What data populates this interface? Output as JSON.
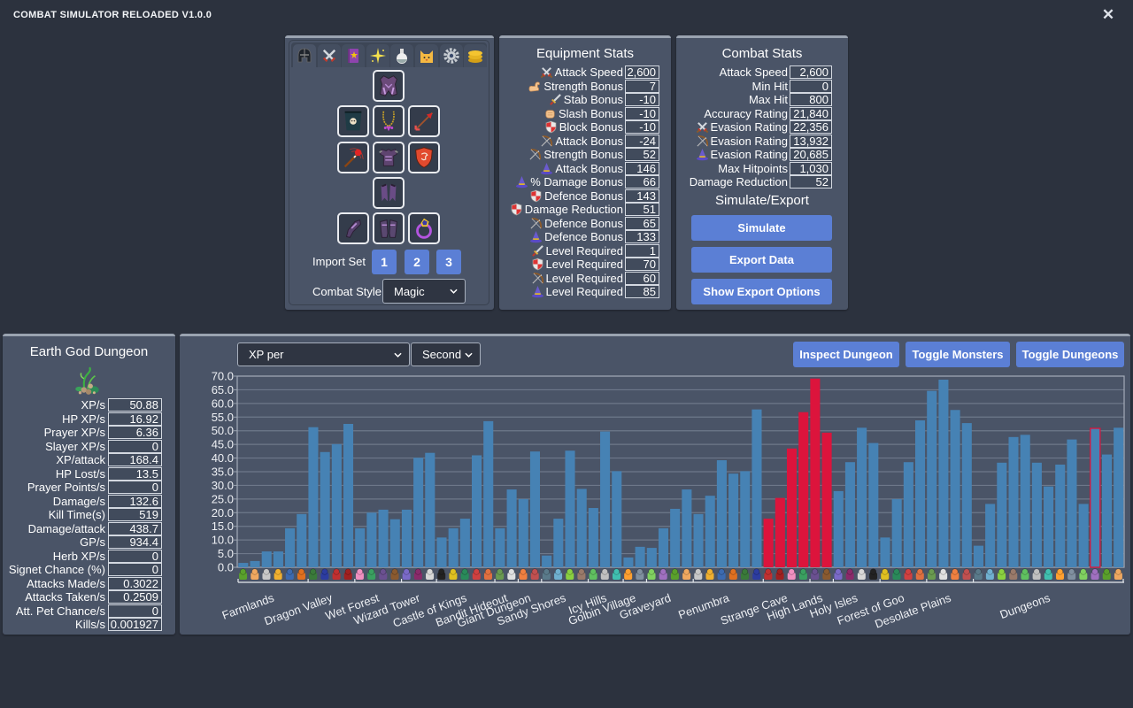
{
  "app": {
    "title": "COMBAT SIMULATOR RELOADED V1.0.0",
    "close_icon": "close-icon",
    "close_glyph": "✕"
  },
  "equipment_panel": {
    "tabs": [
      {
        "id": "equipment",
        "icon": "helmet-icon",
        "active": true
      },
      {
        "id": "combat",
        "icon": "crossed-swords-icon",
        "active": false
      },
      {
        "id": "spellbook",
        "icon": "spellbook-icon",
        "active": false
      },
      {
        "id": "prayer",
        "icon": "sparkle-icon",
        "active": false
      },
      {
        "id": "potions",
        "icon": "potion-icon",
        "active": false
      },
      {
        "id": "pets",
        "icon": "cat-icon",
        "active": false
      },
      {
        "id": "settings",
        "icon": "gear-icon",
        "active": false
      },
      {
        "id": "gp",
        "icon": "coins-icon",
        "active": false
      }
    ],
    "slots": [
      {
        "slot": "helmet",
        "icon": "helmet-slot-icon"
      },
      {
        "slot": "cape",
        "icon": "cape-slot-icon"
      },
      {
        "slot": "amulet",
        "icon": "amulet-slot-icon"
      },
      {
        "slot": "quiver",
        "icon": "arrow-slot-icon"
      },
      {
        "slot": "weapon",
        "icon": "staff-slot-icon"
      },
      {
        "slot": "platebody",
        "icon": "platebody-slot-icon"
      },
      {
        "slot": "shield",
        "icon": "shield-slot-icon"
      },
      {
        "slot": "platelegs",
        "icon": "platelegs-slot-icon"
      },
      {
        "slot": "gloves",
        "icon": "gloves-slot-icon"
      },
      {
        "slot": "boots",
        "icon": "boots-slot-icon"
      },
      {
        "slot": "ring",
        "icon": "ring-slot-icon"
      }
    ],
    "import_set_label": "Import Set",
    "import_buttons": [
      "1",
      "2",
      "3"
    ],
    "combat_style_label": "Combat Style",
    "combat_style_value": "Magic"
  },
  "equipment_stats": {
    "title": "Equipment Stats",
    "rows": [
      {
        "icon": "melee-icon",
        "label": "Attack Speed",
        "value": "2,600"
      },
      {
        "icon": "strength-icon",
        "label": "Strength Bonus",
        "value": "7"
      },
      {
        "icon": "stab-icon",
        "label": "Stab Bonus",
        "value": "-10"
      },
      {
        "icon": "slash-icon",
        "label": "Slash Bonus",
        "value": "-10"
      },
      {
        "icon": "defence-icon",
        "label": "Block Bonus",
        "value": "-10"
      },
      {
        "icon": "ranged-icon",
        "label": "Attack Bonus",
        "value": "-24"
      },
      {
        "icon": "ranged-icon",
        "label": "Strength Bonus",
        "value": "52"
      },
      {
        "icon": "magic-icon",
        "label": "Attack Bonus",
        "value": "146"
      },
      {
        "icon": "magic-icon",
        "label": "% Damage Bonus",
        "value": "66"
      },
      {
        "icon": "defence-icon",
        "label": "Defence Bonus",
        "value": "143"
      },
      {
        "icon": "defence-icon",
        "label": "Damage Reduction",
        "value": "51"
      },
      {
        "icon": "ranged-icon",
        "label": "Defence Bonus",
        "value": "65"
      },
      {
        "icon": "magic-icon",
        "label": "Defence Bonus",
        "value": "133"
      },
      {
        "icon": "attack-icon",
        "label": "Level Required",
        "value": "1"
      },
      {
        "icon": "defence-icon",
        "label": "Level Required",
        "value": "70"
      },
      {
        "icon": "ranged-icon",
        "label": "Level Required",
        "value": "60"
      },
      {
        "icon": "magic-icon",
        "label": "Level Required",
        "value": "85"
      }
    ]
  },
  "combat_stats": {
    "title": "Combat Stats",
    "rows": [
      {
        "icon": null,
        "label": "Attack Speed",
        "value": "2,600"
      },
      {
        "icon": null,
        "label": "Min Hit",
        "value": "0"
      },
      {
        "icon": null,
        "label": "Max Hit",
        "value": "800"
      },
      {
        "icon": null,
        "label": "Accuracy Rating",
        "value": "21,840"
      },
      {
        "icon": "melee-icon",
        "label": "Evasion Rating",
        "value": "22,356"
      },
      {
        "icon": "ranged-icon",
        "label": "Evasion Rating",
        "value": "13,932"
      },
      {
        "icon": "magic-icon",
        "label": "Evasion Rating",
        "value": "20,685"
      },
      {
        "icon": null,
        "label": "Max Hitpoints",
        "value": "1,030"
      },
      {
        "icon": null,
        "label": "Damage Reduction",
        "value": "52"
      }
    ],
    "simulate_export_title": "Simulate/Export",
    "buttons": {
      "simulate": "Simulate",
      "export": "Export Data",
      "show_options": "Show Export Options"
    }
  },
  "dungeon_panel": {
    "title": "Earth God Dungeon",
    "icon": "earth-god-dungeon-icon",
    "rows": [
      {
        "label": "XP/s",
        "value": "50.88"
      },
      {
        "label": "HP XP/s",
        "value": "16.92"
      },
      {
        "label": "Prayer XP/s",
        "value": "6.36"
      },
      {
        "label": "Slayer XP/s",
        "value": "0"
      },
      {
        "label": "XP/attack",
        "value": "168.4"
      },
      {
        "label": "HP Lost/s",
        "value": "13.5"
      },
      {
        "label": "Prayer Points/s",
        "value": "0"
      },
      {
        "label": "Damage/s",
        "value": "132.6"
      },
      {
        "label": "Kill Time(s)",
        "value": "519"
      },
      {
        "label": "Damage/attack",
        "value": "438.7"
      },
      {
        "label": "GP/s",
        "value": "934.4"
      },
      {
        "label": "Herb XP/s",
        "value": "0"
      },
      {
        "label": "Signet Chance (%)",
        "value": "0"
      },
      {
        "label": "Attacks Made/s",
        "value": "0.3022"
      },
      {
        "label": "Attacks Taken/s",
        "value": "0.2509"
      },
      {
        "label": "Att. Pet Chance/s",
        "value": "0"
      },
      {
        "label": "Kills/s",
        "value": "0.001927"
      }
    ]
  },
  "chart_panel": {
    "stat_select": "XP per",
    "time_select": "Second",
    "buttons": {
      "inspect": "Inspect Dungeon",
      "toggle_monsters": "Toggle Monsters",
      "toggle_dungeons": "Toggle Dungeons"
    }
  },
  "chart_data": {
    "type": "bar",
    "title": "",
    "xlabel": "",
    "ylabel": "",
    "metric": "XP per Second",
    "ylim": [
      0,
      70
    ],
    "yticks": [
      "0.0",
      "5.0",
      "10.0",
      "15.0",
      "20.0",
      "25.0",
      "30.0",
      "35.0",
      "40.0",
      "45.0",
      "50.0",
      "55.0",
      "60.0",
      "65.0",
      "70.0"
    ],
    "grid": true,
    "legend": "none",
    "categories": [
      "Farmlands",
      "Dragon Valley",
      "Wet Forest",
      "Wizard Tower",
      "Castle of Kings",
      "Bandit Hideout",
      "Giant Dungeon",
      "Sandy Shores",
      "Icy Hills",
      "Golbin Village",
      "Graveyard",
      "Penumbra",
      "Strange Cave",
      "High Lands",
      "Holy Isles",
      "Forest of Goo",
      "Desolate Plains",
      "Dungeons"
    ],
    "groups": [
      {
        "label": "Farmlands",
        "start": 1,
        "end": 6
      },
      {
        "label": "Dragon Valley",
        "start": 7,
        "end": 10
      },
      {
        "label": "Wet Forest",
        "start": 11,
        "end": 14
      },
      {
        "label": "Wizard Tower",
        "start": 15,
        "end": 17
      },
      {
        "label": "Castle of Kings",
        "start": 18,
        "end": 22
      },
      {
        "label": "Bandit Hideout",
        "start": 23,
        "end": 24
      },
      {
        "label": "Giant Dungeon",
        "start": 25,
        "end": 26
      },
      {
        "label": "Sandy Shores",
        "start": 27,
        "end": 30
      },
      {
        "label": "Icy Hills",
        "start": 31,
        "end": 33
      },
      {
        "label": "Golbin Village",
        "start": 34,
        "end": 35
      },
      {
        "label": "Graveyard",
        "start": 36,
        "end": 39
      },
      {
        "label": "Penumbra",
        "start": 40,
        "end": 45
      },
      {
        "label": "Strange Cave",
        "start": 46,
        "end": 49
      },
      {
        "label": "High Lands",
        "start": 50,
        "end": 51
      },
      {
        "label": "Holy Isles",
        "start": 52,
        "end": 55
      },
      {
        "label": "Forest of Goo",
        "start": 56,
        "end": 59
      },
      {
        "label": "Desolate Plains",
        "start": 60,
        "end": 63
      },
      {
        "label": "Dungeons",
        "start": 64,
        "end": 76
      }
    ],
    "values": [
      1.6,
      2.3,
      5.8,
      5.8,
      14.3,
      19.5,
      51.3,
      42.2,
      45.1,
      52.5,
      14.3,
      20.0,
      21.1,
      17.6,
      21.1,
      40.1,
      41.9,
      10.9,
      14.3,
      17.8,
      41.0,
      53.5,
      14.3,
      28.5,
      25.0,
      42.4,
      4.3,
      17.8,
      42.7,
      28.7,
      21.7,
      49.7,
      35.2,
      3.6,
      7.5,
      7.1,
      14.3,
      21.4,
      28.5,
      19.5,
      26.2,
      39.2,
      34.3,
      35.2,
      57.8,
      17.8,
      25.4,
      43.5,
      56.8,
      69.1,
      49.3,
      27.9,
      38.5,
      51.1,
      45.5,
      10.9,
      25.0,
      38.5,
      53.8,
      64.6,
      68.7,
      57.6,
      52.8,
      7.9,
      23.2,
      38.3,
      47.7,
      48.5,
      38.3,
      29.6,
      37.6,
      46.8,
      23.2,
      50.88,
      41.3,
      51.1
    ],
    "highlighted_bars": [
      46,
      47,
      48,
      49,
      50,
      51
    ],
    "selected_bar": 74,
    "colors": {
      "default": "#4682b4",
      "highlight": "#dc143c",
      "selected_outline": "#dc143c"
    }
  }
}
